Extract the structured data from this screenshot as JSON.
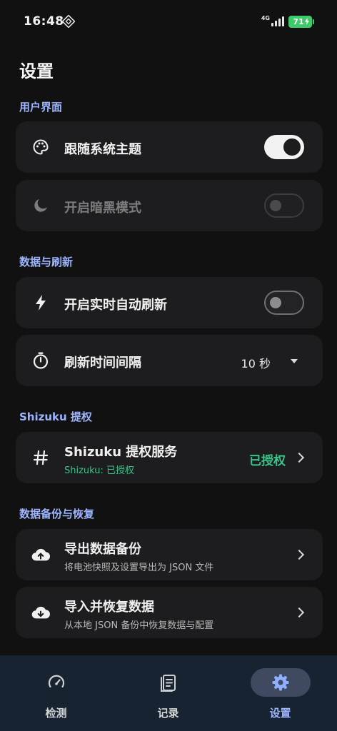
{
  "status_bar": {
    "time": "16:48",
    "network": "4G",
    "battery": "71"
  },
  "page": {
    "title": "设置"
  },
  "sections": {
    "ui": {
      "header": "用户界面",
      "follow_system_theme": {
        "label": "跟随系统主题",
        "toggle": "on"
      },
      "dark_mode": {
        "label": "开启暗黑模式",
        "toggle": "off-disabled"
      }
    },
    "data_refresh": {
      "header": "数据与刷新",
      "realtime_refresh": {
        "label": "开启实时自动刷新",
        "toggle": "off"
      },
      "refresh_interval": {
        "label": "刷新时间间隔",
        "value": "10 秒"
      }
    },
    "shizuku": {
      "header": "Shizuku 提权",
      "service": {
        "label": "Shizuku 提权服务",
        "sub": "Shizuku: 已授权",
        "status": "已授权"
      }
    },
    "backup": {
      "header": "数据备份与恢复",
      "export": {
        "label": "导出数据备份",
        "sub": "将电池快照及设置导出为 JSON 文件"
      },
      "import": {
        "label": "导入并恢复数据",
        "sub": "从本地 JSON 备份中恢复数据与配置"
      }
    }
  },
  "bottom_nav": {
    "items": [
      {
        "label": "检测",
        "icon": "speedometer-icon",
        "active": false
      },
      {
        "label": "记录",
        "icon": "document-list-icon",
        "active": false
      },
      {
        "label": "设置",
        "icon": "gear-icon",
        "active": true
      }
    ]
  },
  "colors": {
    "accent": "#9db4ff",
    "success": "#39c48a",
    "battery": "#3ec96b",
    "nav_bg": "#172330"
  }
}
